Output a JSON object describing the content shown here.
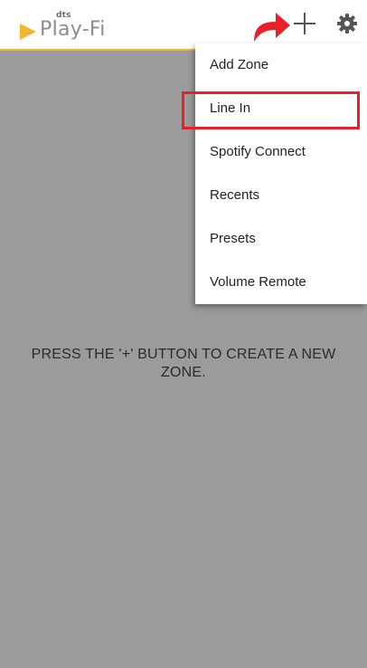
{
  "header": {
    "logo": {
      "brand_small": "dts",
      "brand_main": "Play-Fi"
    },
    "add_button_icon": "plus-icon",
    "settings_icon": "gear-icon",
    "accent_color": "#f2b632"
  },
  "menu": {
    "items": [
      {
        "label": "Add Zone"
      },
      {
        "label": "Line In"
      },
      {
        "label": "Spotify Connect"
      },
      {
        "label": "Recents"
      },
      {
        "label": "Presets"
      },
      {
        "label": "Volume Remote"
      }
    ],
    "highlighted_item": "Line In",
    "highlight_color": "#e8202a"
  },
  "main": {
    "empty_message": "PRESS THE '+' BUTTON TO CREATE A NEW ZONE.",
    "background_color": "#9b9b9b"
  },
  "annotation": {
    "arrow_icon": "curved-arrow-icon",
    "arrow_color": "#e8202a"
  }
}
